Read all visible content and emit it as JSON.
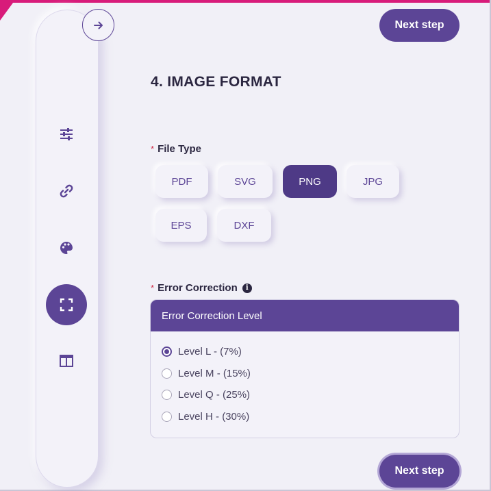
{
  "nav": {
    "toggle_icon": "arrow-right-icon",
    "items": [
      {
        "icon": "sliders-icon",
        "active": false
      },
      {
        "icon": "link-icon",
        "active": false
      },
      {
        "icon": "palette-icon",
        "active": false
      },
      {
        "icon": "expand-icon",
        "active": true
      },
      {
        "icon": "layout-icon",
        "active": false
      }
    ]
  },
  "actions": {
    "next_top": "Next step",
    "next_bottom": "Next step"
  },
  "section": {
    "title": "4. IMAGE FORMAT"
  },
  "file_type": {
    "required_mark": "*",
    "label": "File Type",
    "options": [
      "PDF",
      "SVG",
      "PNG",
      "JPG",
      "EPS",
      "DXF"
    ],
    "selected": "PNG"
  },
  "error_correction": {
    "required_mark": "*",
    "label": "Error Correction",
    "info_icon": "info-icon",
    "card_title": "Error Correction Level",
    "options": [
      "Level L - (7%)",
      "Level M - (15%)",
      "Level Q - (25%)",
      "Level H - (30%)"
    ],
    "selected": "Level L - (7%)"
  },
  "colors": {
    "accent": "#5c4596",
    "selected": "#4e3a86",
    "top_bar": "#d81b7a",
    "background": "#f1f0f7"
  }
}
